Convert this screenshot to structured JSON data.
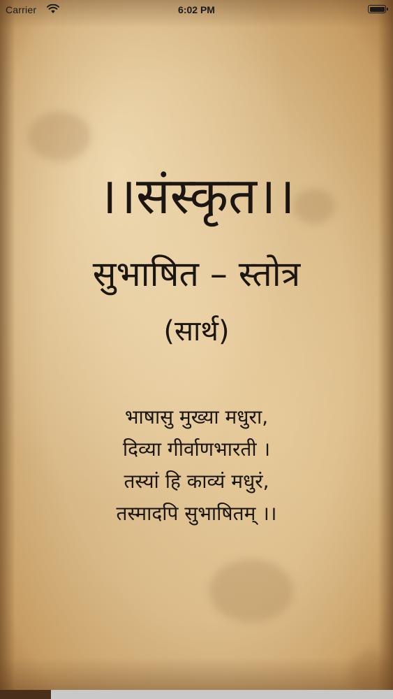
{
  "status_bar": {
    "carrier": "Carrier",
    "time": "6:02 PM",
    "wifi_icon": "wifi-icon",
    "battery_icon": "battery-icon",
    "battery_level": 1.0
  },
  "splash": {
    "title": "।।संस्कृत।।",
    "subtitle": "सुभाषित – स्तोत्र",
    "tag": "(सार्थ)",
    "verse": [
      "भाषासु मुख्या मधुरा,",
      "दिव्या गीर्वाणभारती ।",
      "तस्यां हि काव्यं मधुरं,",
      "तस्मादपि सुभाषितम् ।।"
    ]
  },
  "loading": {
    "progress": 0.13
  },
  "colors": {
    "text": "#1c1612",
    "paper": "#d8b886",
    "progress_fill": "#4a2f1a",
    "progress_track": "#c9c9c9"
  }
}
